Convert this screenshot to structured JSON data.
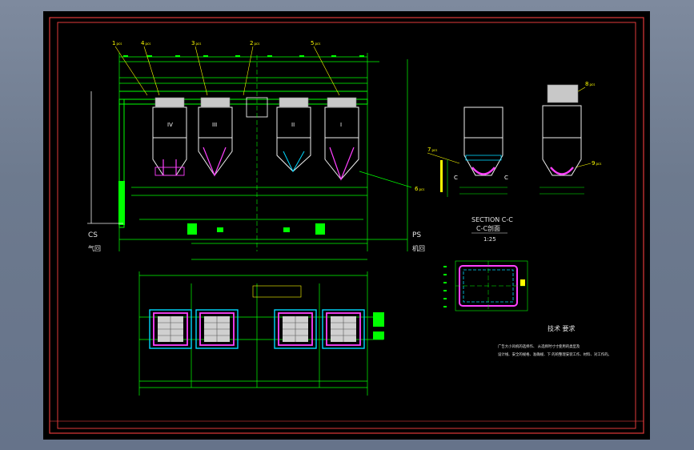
{
  "colors": {
    "background": "#000000",
    "frame_outer": "#ff3b3b",
    "frame_inner": "#e05050",
    "dimension": "#00ff00",
    "structure": "#f0f0f0",
    "magenta": "#ff40ff",
    "cyan": "#00d8ff",
    "yellow": "#ffff00",
    "red": "#ff2020"
  },
  "labels": {
    "cs": "CS",
    "cs_sub": "气回",
    "ps": "PS",
    "ps_sub": "机回",
    "section_title": "SECTION C-C",
    "section_cn": "C-C剖面",
    "section_scale": "1:25",
    "unit_iv": "IV",
    "unit_iii": "III",
    "unit_ii": "II",
    "unit_i": "I",
    "c_left": "C",
    "c_right": "C",
    "tech_title": "技术 要求",
    "tech_line1": "广告大小风机的选择作、 从选择时寸寸使用的类型及",
    "tech_line2": "设计线、安全的规格、准确规、下  的的整理安装工作、材料、对工作的。"
  },
  "callouts": [
    {
      "num": "1",
      "sub": "pcs"
    },
    {
      "num": "4",
      "sub": "pcs"
    },
    {
      "num": "3",
      "sub": "pcs"
    },
    {
      "num": "2",
      "sub": "pcs"
    },
    {
      "num": "5",
      "sub": "pcs"
    },
    {
      "num": "6",
      "sub": "pcs"
    },
    {
      "num": "7",
      "sub": "pcs"
    },
    {
      "num": "8",
      "sub": "pcs"
    },
    {
      "num": "9",
      "sub": "pcs"
    }
  ]
}
